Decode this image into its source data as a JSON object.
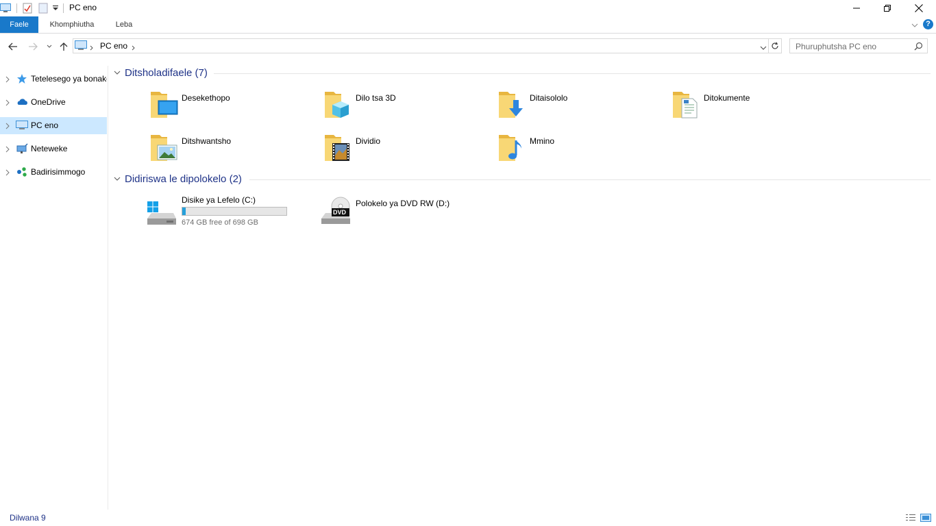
{
  "window": {
    "title": "PC eno"
  },
  "ribbon": {
    "tabs": [
      {
        "label": "Faele",
        "active": true
      },
      {
        "label": "Khomphiutha",
        "active": false
      },
      {
        "label": "Leba",
        "active": false
      }
    ],
    "help": "?"
  },
  "address": {
    "path": "PC eno",
    "search_placeholder": "Phuruphutsha PC eno"
  },
  "nav": {
    "items": [
      {
        "label": "Tetelesego ya bonako",
        "icon": "star-icon"
      },
      {
        "label": "OneDrive",
        "icon": "cloud-icon"
      },
      {
        "label": "PC eno",
        "icon": "computer-icon",
        "selected": true
      },
      {
        "label": "Neteweke",
        "icon": "network-icon"
      },
      {
        "label": "Badirisimmogo",
        "icon": "homegroup-icon"
      }
    ]
  },
  "content": {
    "folders_header": "Ditsholadifaele (7)",
    "folders": [
      {
        "label": "Desekethopo",
        "icon": "desktop-folder-icon"
      },
      {
        "label": "Dilo tsa 3D",
        "icon": "3d-objects-folder-icon"
      },
      {
        "label": "Ditaisololo",
        "icon": "downloads-folder-icon"
      },
      {
        "label": "Ditokumente",
        "icon": "documents-folder-icon"
      },
      {
        "label": "Ditshwantsho",
        "icon": "pictures-folder-icon"
      },
      {
        "label": "Dividio",
        "icon": "videos-folder-icon"
      },
      {
        "label": "Mmino",
        "icon": "music-folder-icon"
      }
    ],
    "drives_header": "Didiriswa le dipolokelo (2)",
    "drives": [
      {
        "label": "Disike ya Lefelo (C:)",
        "free": "674 GB free of 698 GB",
        "used_fraction": 0.034,
        "icon": "hard-drive-icon"
      },
      {
        "label": "Polokelo ya DVD RW (D:)",
        "icon": "dvd-drive-icon",
        "badge": "DVD"
      }
    ]
  },
  "status": {
    "items_count": "Dilwana 9"
  },
  "colors": {
    "accent": "#1979ca",
    "header_text": "#1e3287",
    "selection": "#cce8ff",
    "drive_fill": "#26a0da"
  }
}
